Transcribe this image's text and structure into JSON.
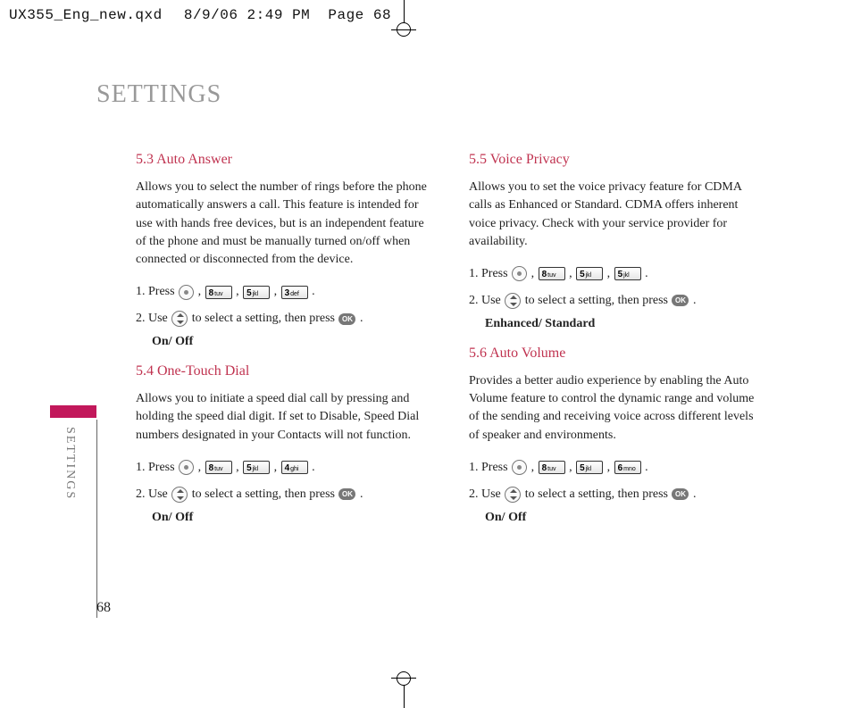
{
  "header": {
    "filename": "UX355_Eng_new.qxd",
    "timestamp": "8/9/06  2:49 PM",
    "page_label": "Page 68"
  },
  "page_title": "SETTINGS",
  "side_tab": "SETTINGS",
  "page_number": "68",
  "keys": {
    "ok": "OK",
    "k8": "8",
    "k8s": "tuv",
    "k5": "5",
    "k5s": "jkl",
    "k3": "3",
    "k3s": "def",
    "k4": "4",
    "k4s": "ghi",
    "k6": "6",
    "k6s": "mno"
  },
  "left": {
    "s53": {
      "heading": "5.3 Auto Answer",
      "para": "Allows you to select the number of rings before the phone automatically answers a call. This feature is intended for use with hands free devices, but is an independent feature of the phone and must be manually turned on/off when connected or disconnected from the device.",
      "step1_a": "1. Press ",
      "step1_b": " , ",
      "step1_c": " , ",
      "step1_d": " , ",
      "step1_e": " .",
      "step2_a": "2. Use ",
      "step2_b": "  to select a setting, then press ",
      "step2_c": " .",
      "options": "On/ Off"
    },
    "s54": {
      "heading": "5.4 One-Touch Dial",
      "para": "Allows you to initiate a speed dial call by pressing and holding the speed dial digit. If set to Disable, Speed Dial numbers designated in your Contacts will not function.",
      "step1_a": "1. Press ",
      "step1_b": " , ",
      "step1_c": " , ",
      "step1_d": " , ",
      "step1_e": " .",
      "step2_a": "2. Use ",
      "step2_b": "  to select a setting, then press ",
      "step2_c": " .",
      "options": "On/ Off"
    }
  },
  "right": {
    "s55": {
      "heading": "5.5 Voice Privacy",
      "para": "Allows you to set the voice privacy feature for CDMA calls as Enhanced or Standard. CDMA offers inherent voice privacy. Check with your service provider for availability.",
      "step1_a": "1. Press ",
      "step1_b": " , ",
      "step1_c": " , ",
      "step1_d": " , ",
      "step1_e": " .",
      "step2_a": "2. Use ",
      "step2_b": "  to select a setting, then press ",
      "step2_c": " .",
      "options": "Enhanced/ Standard"
    },
    "s56": {
      "heading": "5.6 Auto Volume",
      "para": "Provides a better audio experience by enabling the Auto Volume feature to control the dynamic range and volume of the sending and receiving voice across different levels of speaker and environments.",
      "step1_a": "1. Press ",
      "step1_b": " , ",
      "step1_c": " , ",
      "step1_d": " , ",
      "step1_e": " .",
      "step2_a": "2. Use ",
      "step2_b": "  to select a setting, then press ",
      "step2_c": " .",
      "options": "On/ Off"
    }
  }
}
